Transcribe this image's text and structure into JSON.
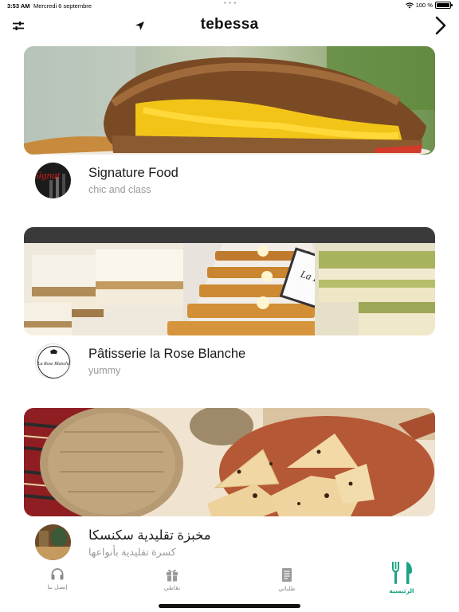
{
  "status_bar": {
    "time": "3:53 AM",
    "date": "Mercredi 6 septembre",
    "dots": "• • •",
    "battery": "100 %"
  },
  "nav": {
    "title": "tebessa",
    "filter_icon": "sliders-icon",
    "location_icon": "location-arrow-icon",
    "forward_icon": "chevron-right-icon"
  },
  "restaurants": [
    {
      "name": "Signature Food",
      "tagline": "chic and class",
      "logo_text": "Signat"
    },
    {
      "name": "Pâtisserie la Rose Blanche",
      "tagline": "yummy",
      "logo_text": "La Rose Blanche"
    },
    {
      "name": "مخبزة تقليدية سكنسكا",
      "tagline": "كسرة تقليدية بأنواعها"
    }
  ],
  "tabs": [
    {
      "label": "إتصل بنا",
      "icon": "headset-icon"
    },
    {
      "label": "نقاطي",
      "icon": "gift-icon"
    },
    {
      "label": "طلباتي",
      "icon": "receipt-icon"
    },
    {
      "label": "الرئيسية",
      "icon": "fork-knife-icon",
      "active": true
    }
  ],
  "colors": {
    "accent": "#1aa383",
    "inactive": "#8a8a8a",
    "tagline": "#9a9a9a"
  }
}
